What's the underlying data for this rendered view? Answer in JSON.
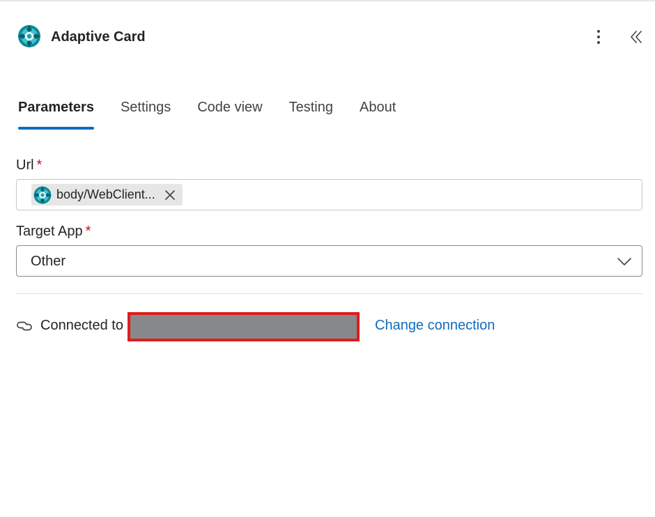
{
  "header": {
    "title": "Adaptive Card",
    "icon": "dynamics-app-icon",
    "more_icon": "more-vertical-icon",
    "collapse_icon": "double-chevron-left-icon"
  },
  "tabs": [
    {
      "label": "Parameters",
      "active": true
    },
    {
      "label": "Settings",
      "active": false
    },
    {
      "label": "Code view",
      "active": false
    },
    {
      "label": "Testing",
      "active": false
    },
    {
      "label": "About",
      "active": false
    }
  ],
  "fields": {
    "url": {
      "label": "Url",
      "required_mark": "*",
      "token_text": "body/WebClient...",
      "token_icon": "dynamics-app-icon"
    },
    "target_app": {
      "label": "Target App",
      "required_mark": "*",
      "value": "Other"
    }
  },
  "connection": {
    "text": "Connected to",
    "change_label": "Change connection"
  },
  "colors": {
    "accent": "#0f6cbd",
    "required": "#c50f1f",
    "redaction_border": "#e21b1b",
    "redaction_fill": "#87888b"
  }
}
